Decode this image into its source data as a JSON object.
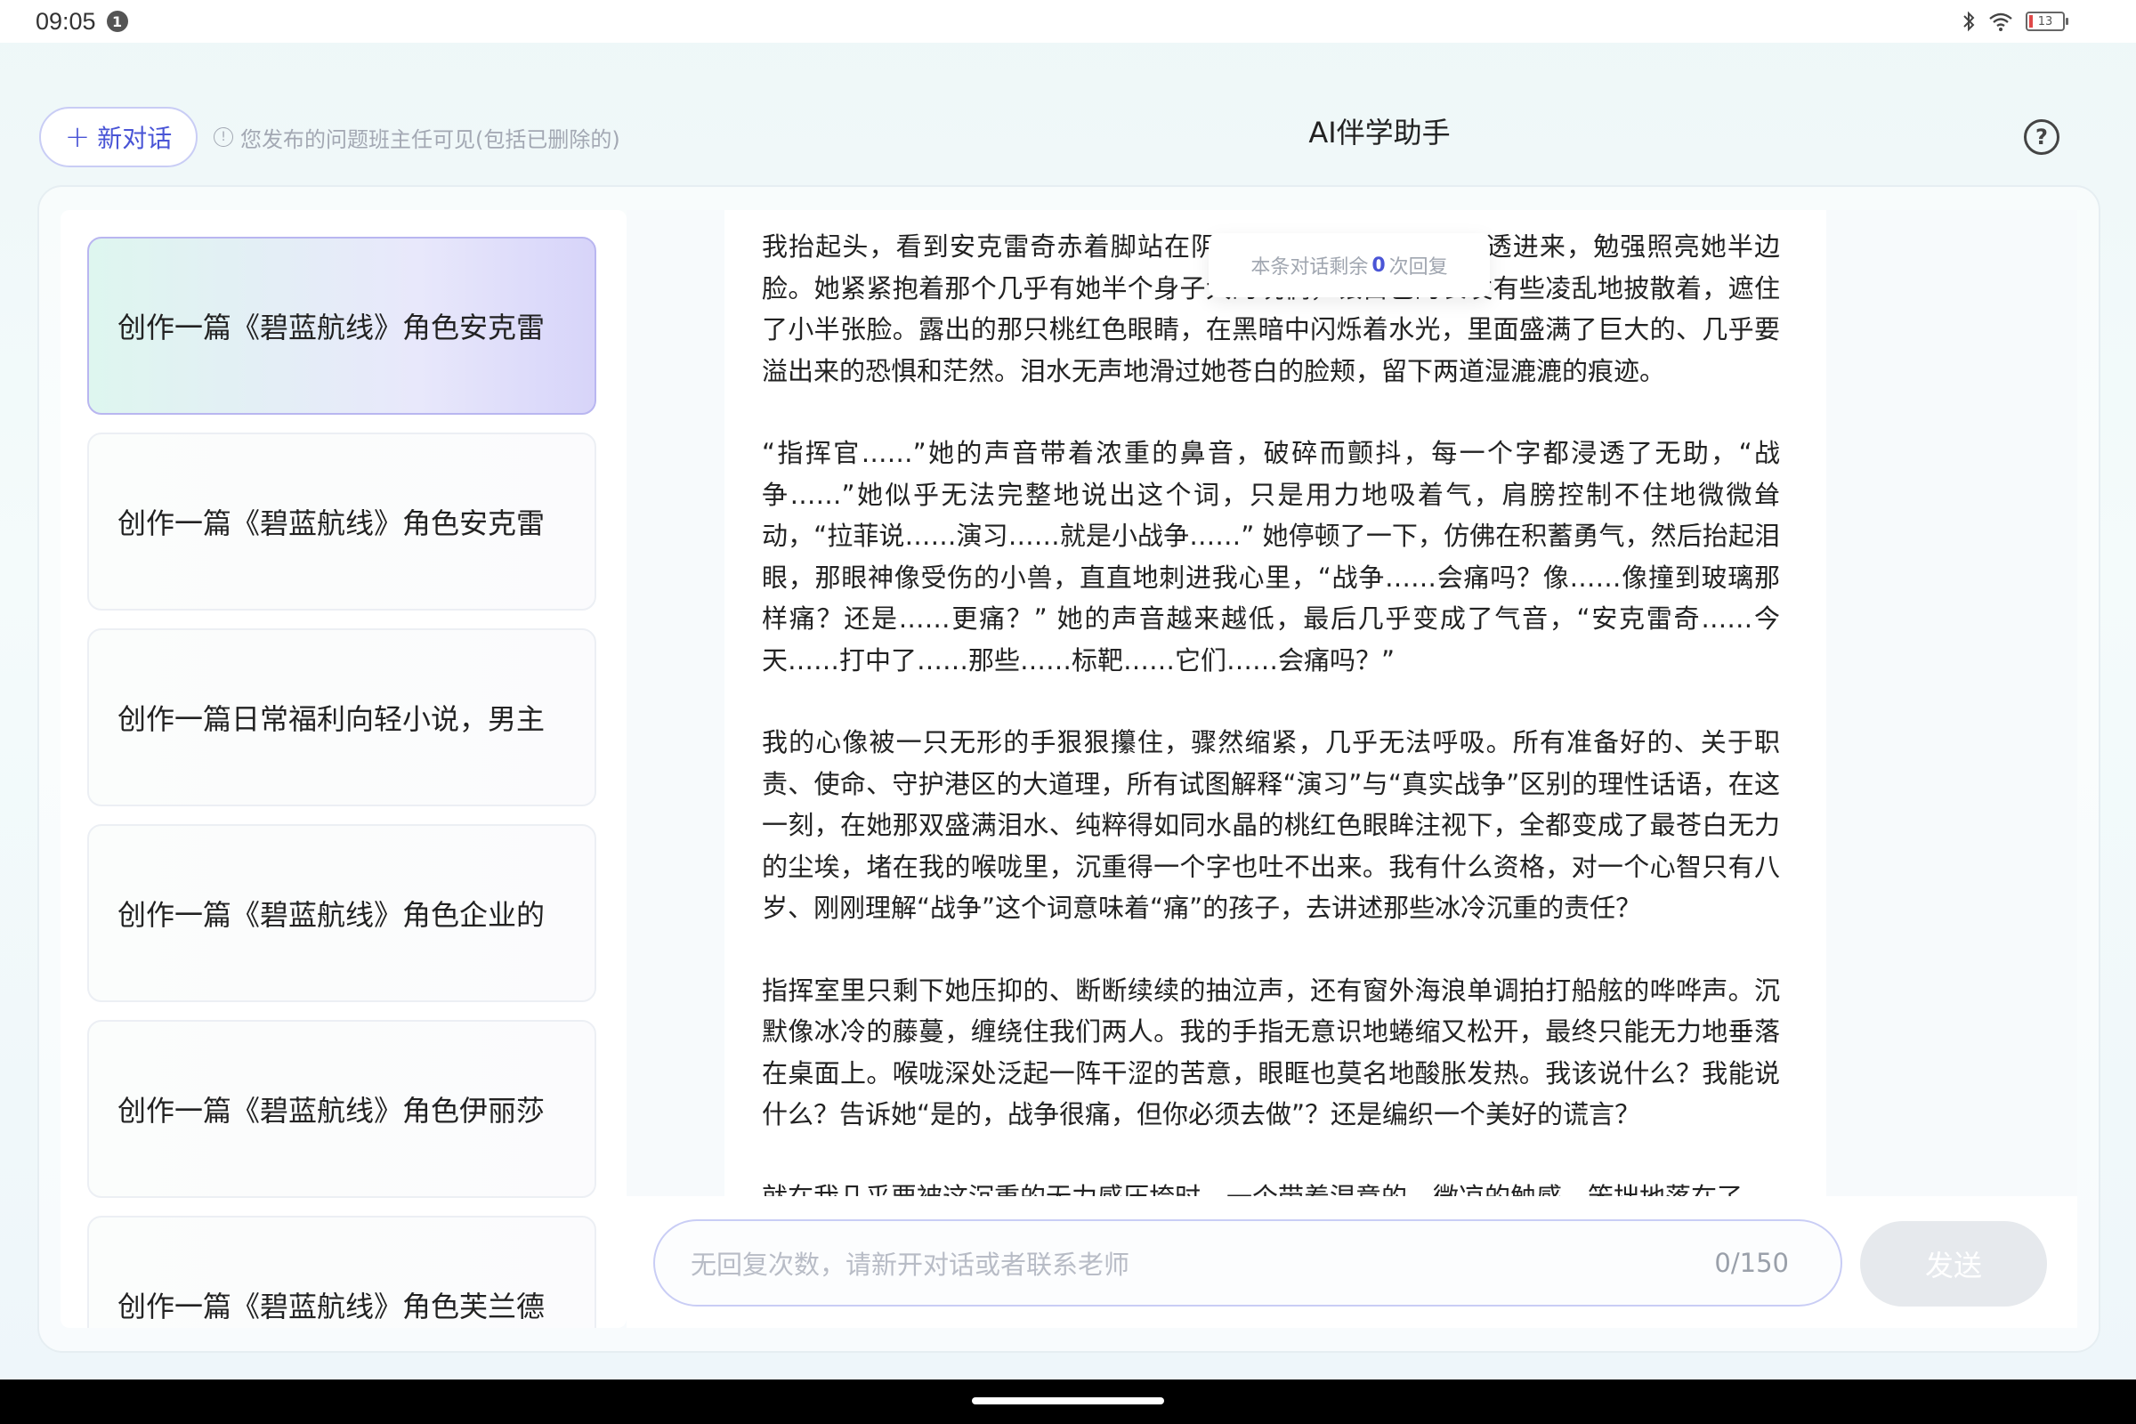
{
  "status_bar": {
    "time": "09:05",
    "notification_count": "1",
    "battery": "13",
    "icons": [
      "bluetooth-icon",
      "wifi-icon",
      "battery-icon"
    ]
  },
  "header": {
    "new_chat_label": "新对话",
    "notice": "您发布的问题班主任可见(包括已删除的)",
    "title": "AI伴学助手"
  },
  "sidebar": {
    "items": [
      {
        "label": "创作一篇《碧蓝航线》角色安克雷",
        "active": true
      },
      {
        "label": "创作一篇《碧蓝航线》角色安克雷",
        "active": false
      },
      {
        "label": "创作一篇日常福利向轻小说，男主",
        "active": false
      },
      {
        "label": "创作一篇《碧蓝航线》角色企业的",
        "active": false
      },
      {
        "label": "创作一篇《碧蓝航线》角色伊丽莎",
        "active": false
      },
      {
        "label": "创作一篇《碧蓝航线》角色芙兰德",
        "active": false
      }
    ]
  },
  "popup": {
    "prefix": "本条对话剩余",
    "count": "0",
    "suffix": "次回复"
  },
  "message": {
    "paragraphs": [
      "我抬起头，看到安克雷奇赤着脚站在阴影里，月光从舷窗斜斜透进来，勉强照亮她半边脸。她紧紧抱着那个几乎有她半个身子大的玩偶，银白色的长发有些凌乱地披散着，遮住了小半张脸。露出的那只桃红色眼睛，在黑暗中闪烁着水光，里面盛满了巨大的、几乎要溢出来的恐惧和茫然。泪水无声地滑过她苍白的脸颊，留下两道湿漉漉的痕迹。",
      "“指挥官……”她的声音带着浓重的鼻音，破碎而颤抖，每一个字都浸透了无助，“战争……”她似乎无法完整地说出这个词，只是用力地吸着气，肩膀控制不住地微微耸动，“拉菲说……演习……就是小战争……” 她停顿了一下，仿佛在积蓄勇气，然后抬起泪眼，那眼神像受伤的小兽，直直地刺进我心里，“战争……会痛吗？像……像撞到玻璃那样痛？还是……更痛？” 她的声音越来越低，最后几乎变成了气音，“安克雷奇……今天……打中了……那些……标靶……它们……会痛吗？”",
      "我的心像被一只无形的手狠狠攥住，骤然缩紧，几乎无法呼吸。所有准备好的、关于职责、使命、守护港区的大道理，所有试图解释“演习”与“真实战争”区别的理性话语，在这一刻，在她那双盛满泪水、纯粹得如同水晶的桃红色眼眸注视下，全都变成了最苍白无力的尘埃，堵在我的喉咙里，沉重得一个字也吐不出来。我有什么资格，对一个心智只有八岁、刚刚理解“战争”这个词意味着“痛”的孩子，去讲述那些冰冷沉重的责任？",
      "指挥室里只剩下她压抑的、断断续续的抽泣声，还有窗外海浪单调拍打船舷的哗哗声。沉默像冰冷的藤蔓，缠绕住我们两人。我的手指无意识地蜷缩又松开，最终只能无力地垂落在桌面上。喉咙深处泛起一阵干涩的苦意，眼眶也莫名地酸胀发热。我该说什么？我能说什么？告诉她“是的，战争很痛，但你必须去做”？还是编织一个美好的谎言？",
      "就在我几乎要被这沉重的无力感压垮时，一个带着湿意的、微凉的触感，笨拙地落在了"
    ]
  },
  "input": {
    "placeholder": "无回复次数，请新开对话或者联系老师",
    "char_count": "0/150",
    "send_label": "发送"
  }
}
